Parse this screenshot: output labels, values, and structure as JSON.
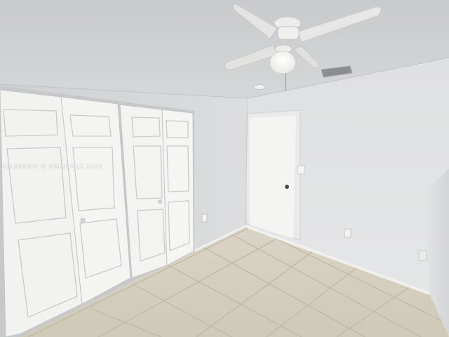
{
  "photo": {
    "subject": "Empty bedroom with white bifold closet doors, interior door, ceiling fan with light, and light beige diagonal floor tile",
    "watermark": "A11888309 © Miami MLS 2025"
  },
  "colors": {
    "ceiling": "#cfd0d1",
    "left_wall": "#d7d8d9",
    "back_wall": "#e1e2e3",
    "right_wall": "#dcdddf",
    "floor": "#d8d3c4",
    "grout": "#bdb7a6",
    "door": "#f3f3f2",
    "door_panel_line": "#c9cacb",
    "baseboard": "#f0f0ef"
  }
}
